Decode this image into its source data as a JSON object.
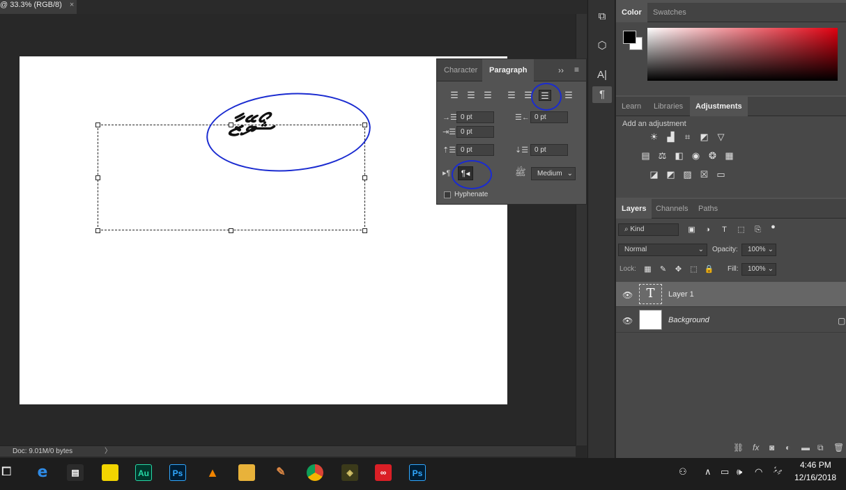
{
  "document": {
    "tab_title": "@ 33.3% (RGB/8)",
    "close_glyph": "×",
    "thaana_text": "ޝޯވޭޒާ",
    "status": "Doc: 9.01M/0 bytes",
    "status_arrow": "〉"
  },
  "color_panel": {
    "tabs": [
      "Color",
      "Swatches"
    ]
  },
  "adjust_panel": {
    "tabs": [
      "Learn",
      "Libraries",
      "Adjustments"
    ],
    "add_label": "Add an adjustment"
  },
  "paragraph_panel": {
    "tabs": [
      "Character",
      "Paragraph"
    ],
    "collapse_glyph": "››",
    "menu_glyph": "≡",
    "indent_left": "0 pt",
    "indent_right": "0 pt",
    "first_line": "0 pt",
    "space_before": "0 pt",
    "space_after": "0 pt",
    "justification": "Medium",
    "hyphenate_label": "Hyphenate",
    "rtl_glyph": "¶◂"
  },
  "layers_panel": {
    "tabs": [
      "Layers",
      "Channels",
      "Paths"
    ],
    "filter_placeholder": "Kind",
    "blend_mode": "Normal",
    "opacity_label": "Opacity:",
    "opacity_value": "100%",
    "lock_label": "Lock:",
    "fill_label": "Fill:",
    "fill_value": "100%",
    "layers": [
      {
        "name": "Layer 1",
        "type": "text",
        "thumb_glyph": "T"
      },
      {
        "name": "Background",
        "type": "image"
      }
    ]
  },
  "toolstrip": {
    "items": [
      "history-icon",
      "3d-icon",
      "character-icon",
      "paragraph-icon"
    ],
    "character_glyph": "A|",
    "paragraph_glyph": "¶"
  },
  "taskbar": {
    "apps": [
      {
        "name": "edge",
        "glyph": "e",
        "color": "#1a73d9"
      },
      {
        "name": "store",
        "glyph": "🛍",
        "color": "#2b2b2b"
      },
      {
        "name": "sticky-notes",
        "glyph": "",
        "color": "#f2d400"
      },
      {
        "name": "audition",
        "glyph": "Au",
        "color": "#00372b"
      },
      {
        "name": "photoshop",
        "glyph": "Ps",
        "color": "#001d34"
      },
      {
        "name": "vlc",
        "glyph": "▲",
        "color": "#2b2b2b"
      },
      {
        "name": "file-explorer",
        "glyph": "▬",
        "color": "#e8b23a"
      },
      {
        "name": "paint",
        "glyph": "✎",
        "color": "#2b2b2b"
      },
      {
        "name": "chrome",
        "glyph": "●",
        "color": "#2b2b2b"
      },
      {
        "name": "quran-app",
        "glyph": "◈",
        "color": "#3b3a1a"
      },
      {
        "name": "creative-cloud",
        "glyph": "∞",
        "color": "#da1f26"
      },
      {
        "name": "photoshop-2",
        "glyph": "Ps",
        "color": "#001d34"
      }
    ],
    "time": "4:46 PM",
    "date": "12/16/2018",
    "language": "ދިވެ"
  },
  "colors": {
    "accent_annotation": "#1a2bd0",
    "panel_bg": "#535353",
    "workspace_bg": "#282828"
  }
}
